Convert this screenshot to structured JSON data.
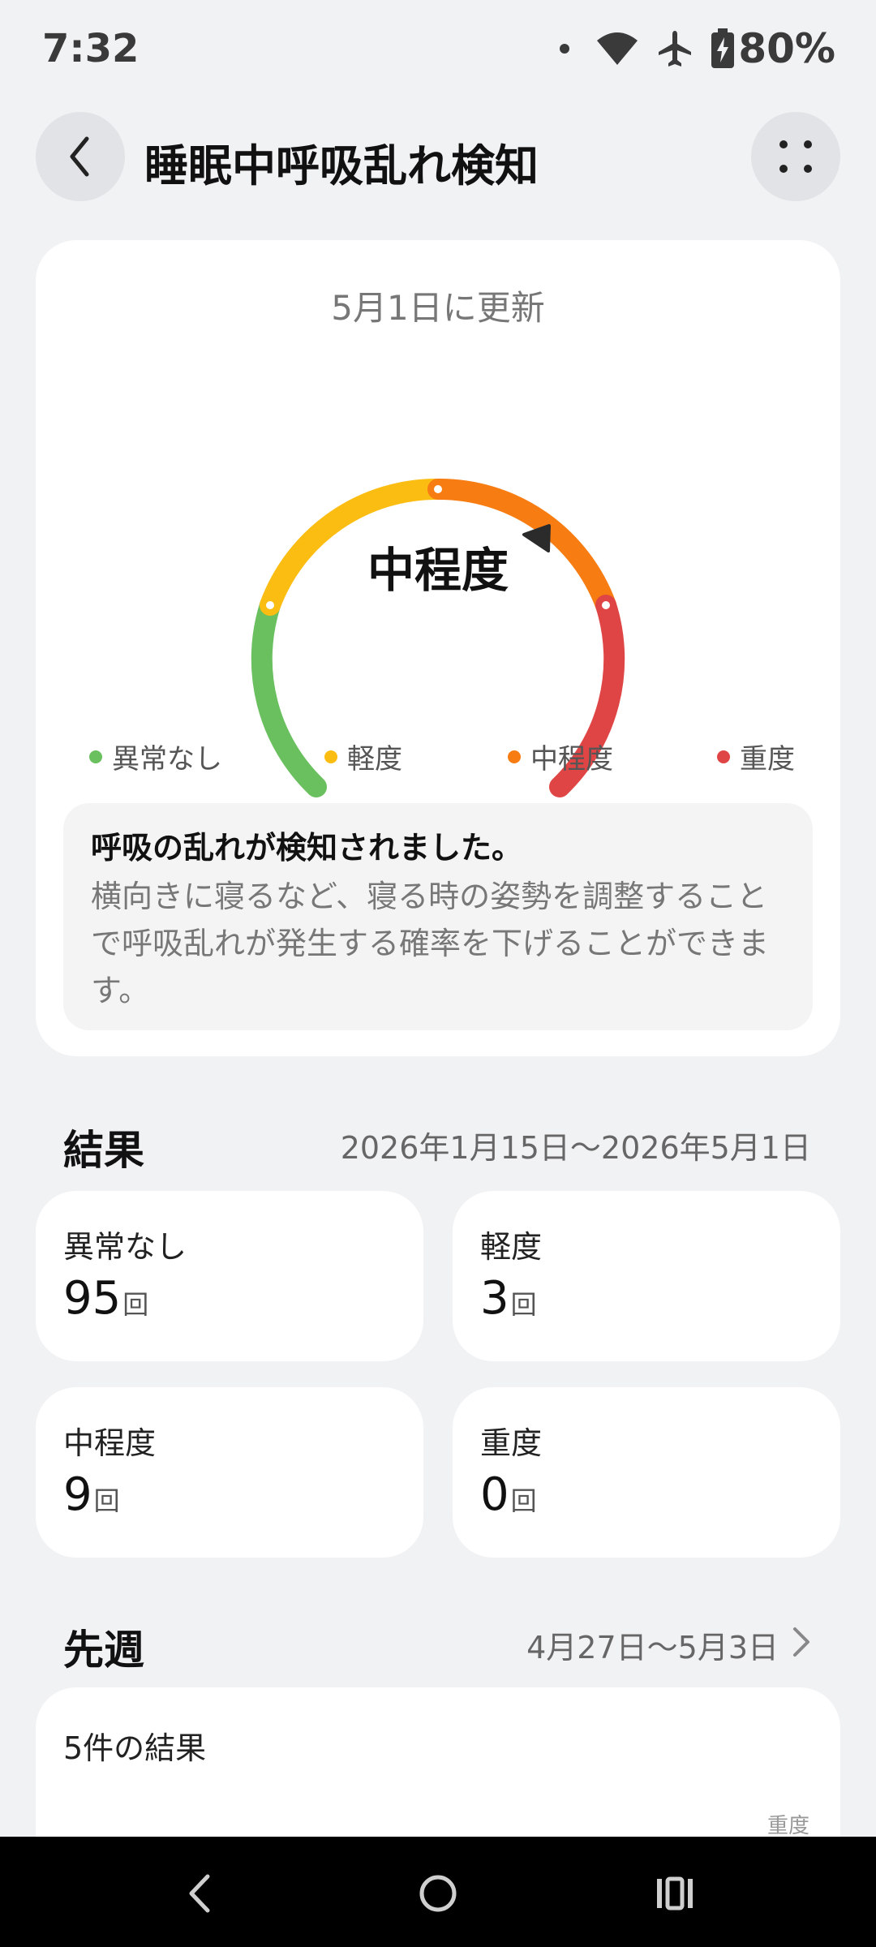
{
  "status_bar": {
    "time": "7:32",
    "battery": "80%",
    "icons": [
      "notification-dot-icon",
      "wifi-icon",
      "airplane-mode-icon",
      "battery-charging-icon"
    ]
  },
  "header": {
    "title": "睡眠中呼吸乱れ検知",
    "back_icon": "chevron-left-icon",
    "more_icon": "more-grid-icon"
  },
  "status_card": {
    "updated": "5月1日に更新",
    "gauge_level": "中程度",
    "legend": [
      {
        "label": "異常なし",
        "color": "#6abf5e"
      },
      {
        "label": "軽度",
        "color": "#fbbd12"
      },
      {
        "label": "中程度",
        "color": "#f77c12"
      },
      {
        "label": "重度",
        "color": "#e04545"
      }
    ],
    "info_title": "呼吸の乱れが検知されました。",
    "info_body": "横向きに寝るなど、寝る時の姿勢を調整することで呼吸乱れが発生する確率を下げることができます。"
  },
  "results": {
    "title": "結果",
    "range": "2026年1月15日～2026年5月1日",
    "stats": [
      {
        "label": "異常なし",
        "value": "95",
        "unit": "回"
      },
      {
        "label": "軽度",
        "value": "3",
        "unit": "回"
      },
      {
        "label": "中程度",
        "value": "9",
        "unit": "回"
      },
      {
        "label": "重度",
        "value": "0",
        "unit": "回"
      }
    ]
  },
  "last_week": {
    "title": "先週",
    "range": "4月27日～5月3日",
    "card_title": "5件の結果",
    "axis_label": "重度"
  },
  "nav_bar": {
    "icons": [
      "nav-back-icon",
      "nav-home-icon",
      "nav-recents-icon"
    ]
  }
}
